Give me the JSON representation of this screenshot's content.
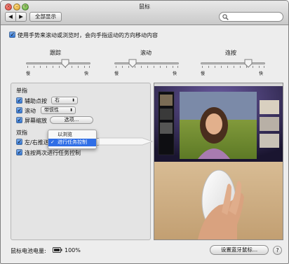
{
  "window": {
    "title": "鼠标",
    "show_all_label": "全部显示",
    "search_placeholder": ""
  },
  "top_option": {
    "label": "使用手势来滚动或浏览时，会向手指运动的方向移动内容",
    "checked": true
  },
  "sliders": [
    {
      "title": "跟踪",
      "min_label": "慢",
      "max_label": "快",
      "level_percent": 55
    },
    {
      "title": "滚动",
      "min_label": "慢",
      "max_label": "快",
      "level_percent": 30
    },
    {
      "title": "连按",
      "min_label": "慢",
      "max_label": "快",
      "level_percent": 72
    }
  ],
  "one_finger": {
    "heading": "单指",
    "secondary_click": {
      "label": "辅助点按",
      "value": "右",
      "checked": true
    },
    "scroll": {
      "label": "滚动",
      "value": "带惯性",
      "checked": true
    },
    "zoom": {
      "label": "屏幕缩放",
      "options_button": "选项...",
      "checked": true
    }
  },
  "two_finger": {
    "heading": "双指",
    "swipe": {
      "label": "左/右推送",
      "checked": true
    },
    "double_tap": {
      "label": "连按两次进行任务控制",
      "checked": true
    }
  },
  "context_menu": {
    "items": [
      {
        "label": "以浏览",
        "checked": false,
        "highlighted": false
      },
      {
        "label": "进行任务控制",
        "checked": true,
        "highlighted": true
      }
    ],
    "highlight_color": "#2f6ee6"
  },
  "footer": {
    "battery_label": "鼠标电池电量:",
    "battery_percent": "100%",
    "battery_level": 1.0,
    "bluetooth_button": "设置蓝牙鼠标...",
    "help_label": "?"
  }
}
